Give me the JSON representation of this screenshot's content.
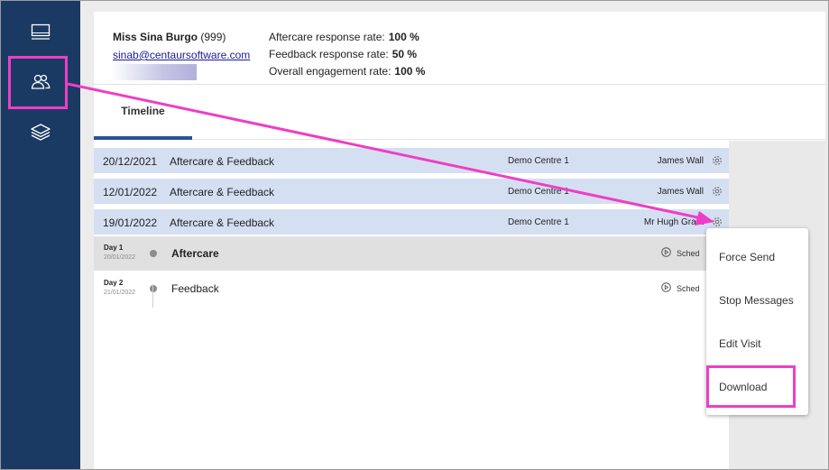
{
  "sidebar": {
    "items": [
      {
        "icon": "monitor-icon"
      },
      {
        "icon": "users-icon"
      },
      {
        "icon": "layers-icon"
      }
    ]
  },
  "patient": {
    "name": "Miss Sina Burgo",
    "id": "(999)",
    "email": "sinab@centaursoftware.com"
  },
  "stats": [
    {
      "label": "Aftercare response rate:",
      "value": "100 %"
    },
    {
      "label": "Feedback response rate:",
      "value": "50 %"
    },
    {
      "label": "Overall engagement rate:",
      "value": "100 %"
    }
  ],
  "tabs": {
    "timeline": "Timeline"
  },
  "visits": [
    {
      "date": "20/12/2021",
      "type": "Aftercare & Feedback",
      "centre": "Demo Centre 1",
      "staff": "James Wall"
    },
    {
      "date": "12/01/2022",
      "type": "Aftercare & Feedback",
      "centre": "Demo Centre 1",
      "staff": "James Wall"
    },
    {
      "date": "19/01/2022",
      "type": "Aftercare & Feedback",
      "centre": "Demo Centre 1",
      "staff": "Mr Hugh Grant"
    }
  ],
  "days": [
    {
      "label": "Day 1",
      "date": "20/01/2022",
      "title": "Aftercare",
      "status": "Sched"
    },
    {
      "label": "Day 2",
      "date": "21/01/2022",
      "title": "Feedback",
      "status": "Sched"
    }
  ],
  "context_menu": {
    "force_send": "Force Send",
    "stop_messages": "Stop Messages",
    "edit_visit": "Edit Visit",
    "download": "Download"
  },
  "colors": {
    "sidebar": "#1b3a63",
    "row_highlight": "#d5dff2",
    "annotation": "#ee3ec6",
    "tab_underline": "#27558e"
  }
}
